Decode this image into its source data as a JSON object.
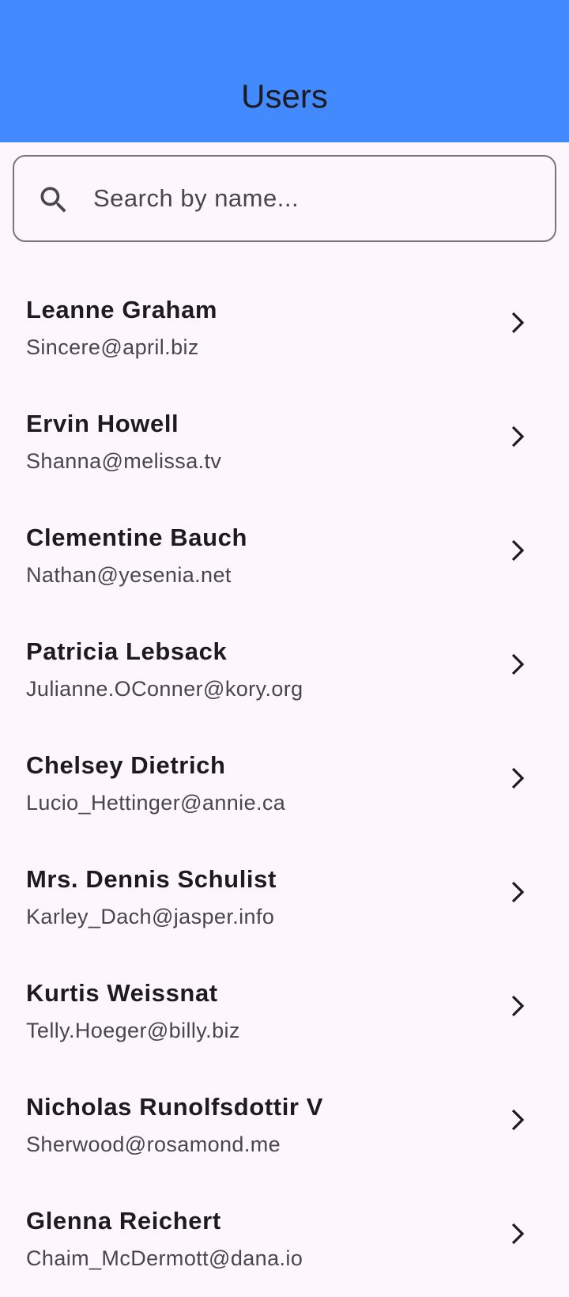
{
  "app_bar": {
    "title": "Users",
    "background": "#448aff"
  },
  "search": {
    "placeholder": "Search by name...",
    "value": ""
  },
  "users": [
    {
      "name": "Leanne Graham",
      "email": "Sincere@april.biz"
    },
    {
      "name": "Ervin Howell",
      "email": "Shanna@melissa.tv"
    },
    {
      "name": "Clementine Bauch",
      "email": "Nathan@yesenia.net"
    },
    {
      "name": "Patricia Lebsack",
      "email": "Julianne.OConner@kory.org"
    },
    {
      "name": "Chelsey Dietrich",
      "email": "Lucio_Hettinger@annie.ca"
    },
    {
      "name": "Mrs. Dennis Schulist",
      "email": "Karley_Dach@jasper.info"
    },
    {
      "name": "Kurtis Weissnat",
      "email": "Telly.Hoeger@billy.biz"
    },
    {
      "name": "Nicholas Runolfsdottir V",
      "email": "Sherwood@rosamond.me"
    },
    {
      "name": "Glenna Reichert",
      "email": "Chaim_McDermott@dana.io"
    }
  ]
}
